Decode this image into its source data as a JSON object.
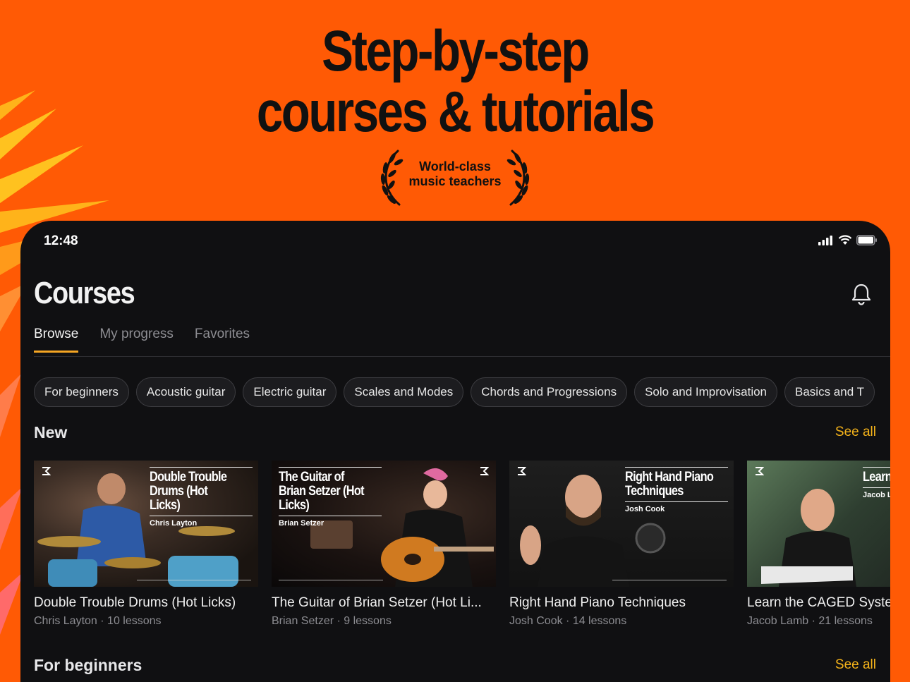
{
  "promo": {
    "headline_line1": "Step-by-step",
    "headline_line2": "courses & tutorials",
    "award_line1": "World-class",
    "award_line2": "music teachers",
    "accent_color": "#ff5a05"
  },
  "status_bar": {
    "time": "12:48",
    "icons": [
      "cellular-signal-icon",
      "wifi-icon",
      "battery-icon"
    ]
  },
  "header": {
    "title": "Courses",
    "notification_icon": "bell-icon"
  },
  "tabs": [
    {
      "label": "Browse",
      "active": true
    },
    {
      "label": "My progress",
      "active": false
    },
    {
      "label": "Favorites",
      "active": false
    }
  ],
  "filters": [
    "For beginners",
    "Acoustic guitar",
    "Electric guitar",
    "Scales and Modes",
    "Chords and Progressions",
    "Solo and Improvisation",
    "Basics and T"
  ],
  "sections": {
    "new": {
      "title": "New",
      "see_all": "See all",
      "courses": [
        {
          "title": "Double Trouble Drums (Hot Licks)",
          "overlay_title": "Double Trouble Drums (Hot Licks)",
          "author": "Chris Layton",
          "meta": "Chris Layton · 10 lessons"
        },
        {
          "title": "The Guitar of Brian Setzer (Hot Li...",
          "overlay_title": "The Guitar of Brian Setzer (Hot Licks)",
          "author": "Brian Setzer",
          "meta": "Brian Setzer · 9 lessons"
        },
        {
          "title": "Right Hand Piano Techniques",
          "overlay_title": "Right Hand Piano Techniques",
          "author": "Josh Cook",
          "meta": "Josh Cook · 14 lessons"
        },
        {
          "title": "Learn the CAGED Syste",
          "overlay_title": "Learn Syste",
          "author": "Jacob L",
          "meta": "Jacob Lamb · 21 lessons"
        }
      ]
    },
    "beginners": {
      "title": "For beginners",
      "see_all": "See all"
    }
  },
  "colors": {
    "link": "#f5b31a",
    "tab_indicator": "#f5a623",
    "app_background": "#101012"
  }
}
